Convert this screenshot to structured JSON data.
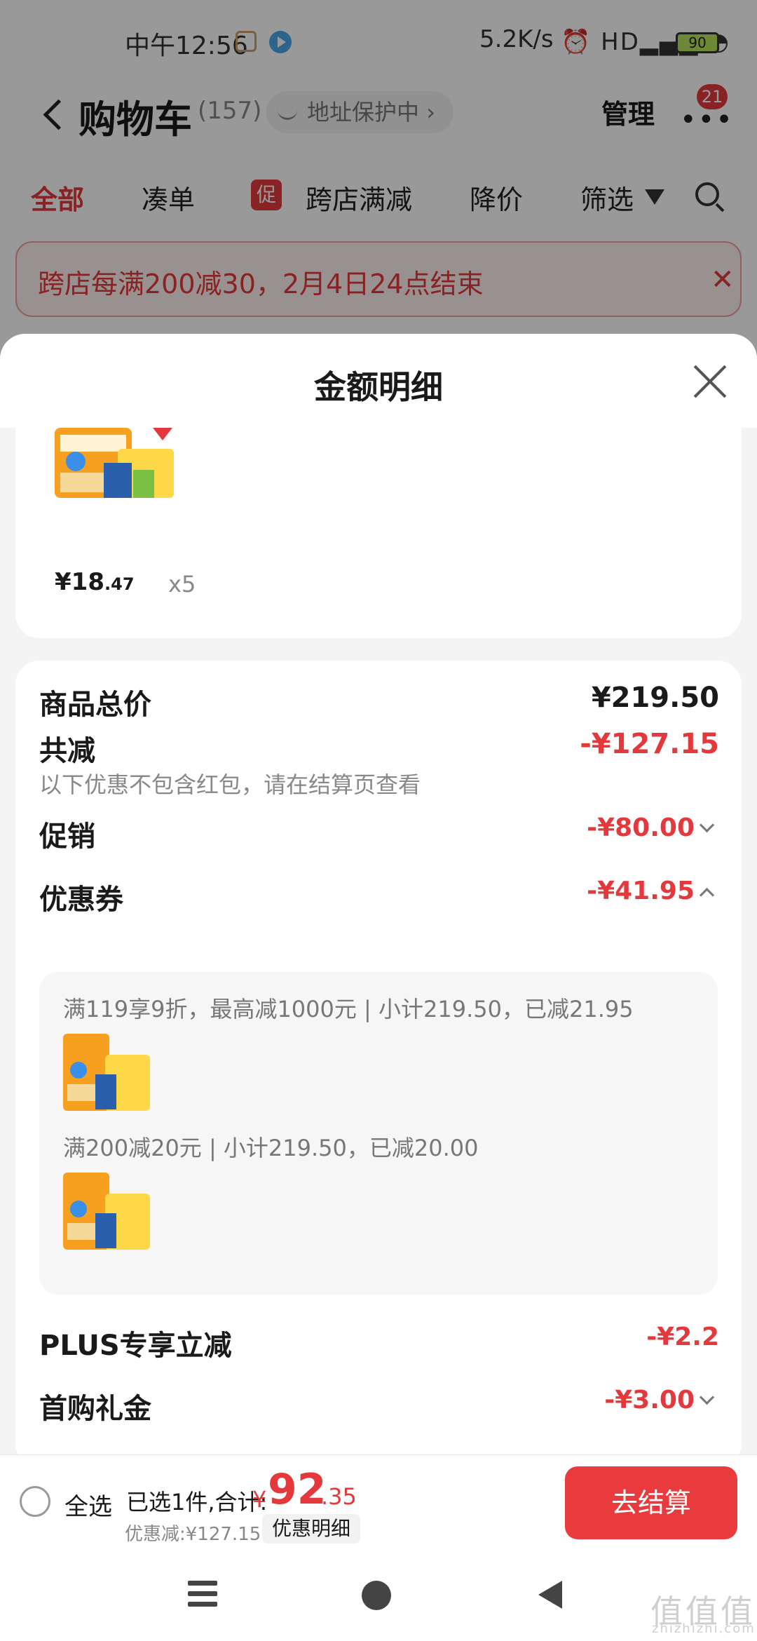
{
  "status_bar": {
    "time": "中午12:56",
    "net_speed": "5.2K/s",
    "signal": "HD",
    "battery": "90"
  },
  "header": {
    "title": "购物车",
    "count": "(157)",
    "address_badge": "地址保护中",
    "manage": "管理",
    "more_badge": "21"
  },
  "tabs": [
    {
      "label": "全部"
    },
    {
      "label": "凑单"
    },
    {
      "label": "跨店满减",
      "tag": "促"
    },
    {
      "label": "降价"
    },
    {
      "label": "筛选"
    }
  ],
  "promo": {
    "text": "跨店每满200减30，2月4日24点结束"
  },
  "sheet": {
    "title": "金额明细",
    "product": {
      "price_symbol": "¥",
      "price_int": "18",
      "price_dec": ".47",
      "qty": "x5"
    },
    "rows": {
      "total": {
        "label": "商品总价",
        "value": "¥219.50"
      },
      "reduce": {
        "label": "共减",
        "value": "-¥127.15",
        "note": "以下优惠不包含红包，请在结算页查看"
      },
      "promotion": {
        "label": "促销",
        "value": "-¥80.00"
      },
      "coupon": {
        "label": "优惠券",
        "value": "-¥41.95"
      },
      "plus": {
        "label": "PLUS专享立减",
        "value": "-¥2.2"
      },
      "first": {
        "label": "首购礼金",
        "value": "-¥3.00"
      }
    },
    "coupons": [
      {
        "text": "满119享9折，最高减1000元 | 小计219.50，已减21.95"
      },
      {
        "text": "满200减20元 | 小计219.50，已减20.00"
      }
    ]
  },
  "bottom_bar": {
    "select_all": "全选",
    "selected": "已选1件,合计:",
    "total_symbol": "¥",
    "total_int": "92",
    "total_dec": ".35",
    "discount": "优惠减:¥127.15",
    "detail_button": "优惠明细",
    "checkout": "去结算"
  },
  "watermark": {
    "text": "值值值",
    "sub": "zhizhizhi.com"
  },
  "colors": {
    "accent": "#e4393c",
    "promo_bg": "#fff0f0",
    "sheet_bg": "#f4f4f4"
  },
  "icons": [
    "back-icon",
    "shield-icon",
    "more-icon",
    "filter-icon",
    "search-icon",
    "close-icon",
    "chevron-down-icon",
    "chevron-up-icon",
    "radio-icon",
    "menu-icon",
    "home-icon",
    "nav-back-icon"
  ]
}
